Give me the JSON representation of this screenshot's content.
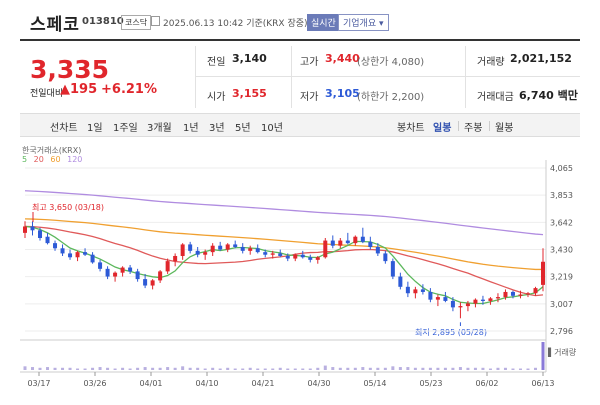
{
  "header": {
    "name": "스페코",
    "code": "013810",
    "market": "코스닥",
    "datetime": "2025.06.13 10:42 기준(KRX 장중)",
    "realtime_btn": "실시간",
    "company_btn": "기업개요 ▾"
  },
  "price": {
    "current": "3,335",
    "change_label": "전일대비",
    "change_amount": "▲195",
    "change_pct": "+6.21%",
    "color_up": "#e0262c",
    "color_down": "#2d5ad6"
  },
  "stats": {
    "prev_label": "전일",
    "prev_value": "3,140",
    "open_label": "시가",
    "open_value": "3,155",
    "high_label": "고가",
    "high_value": "3,440",
    "upper_limit": "(상한가 4,080)",
    "low_label": "저가",
    "low_value": "3,105",
    "lower_limit": "(하한가 2,200)",
    "volume_label": "거래량",
    "volume_value": "2,021,152",
    "amount_label": "거래대금",
    "amount_value": "6,740 백만"
  },
  "tabs": {
    "period_tabs": [
      "선차트",
      "1일",
      "1주일",
      "3개월",
      "1년",
      "3년",
      "5년",
      "10년"
    ],
    "candle_label": "봉차트",
    "candle_tabs": [
      "일봉",
      "주봉",
      "월봉"
    ],
    "selected_candle": "일봉"
  },
  "chart_legend": {
    "source": "한국거래소(KRX)",
    "ma": [
      {
        "name": "5",
        "color": "#5cb85c"
      },
      {
        "name": "20",
        "color": "#e05a5a"
      },
      {
        "name": "60",
        "color": "#f0a030"
      },
      {
        "name": "120",
        "color": "#b08ce0"
      }
    ]
  },
  "annotations": {
    "max": "최고 3,650 (03/18)",
    "min": "최저 2,895 (05/28)",
    "volume_label": "▌거래량"
  },
  "chart_data": {
    "type": "candlestick",
    "y_ticks": [
      "4,065",
      "3,853",
      "3,642",
      "3,430",
      "3,219",
      "3,007",
      "2,796"
    ],
    "ylim": [
      2796,
      4065
    ],
    "x_ticks": [
      "03/17",
      "03/26",
      "04/01",
      "04/10",
      "04/21",
      "04/30",
      "05/14",
      "05/23",
      "06/02",
      "06/13"
    ],
    "candles": [
      [
        3560,
        3650,
        3520,
        3610
      ],
      [
        3610,
        3650,
        3540,
        3580
      ],
      [
        3580,
        3600,
        3500,
        3520
      ],
      [
        3530,
        3560,
        3470,
        3480
      ],
      [
        3480,
        3500,
        3420,
        3440
      ],
      [
        3440,
        3470,
        3380,
        3400
      ],
      [
        3400,
        3430,
        3350,
        3370
      ],
      [
        3370,
        3420,
        3340,
        3410
      ],
      [
        3410,
        3440,
        3380,
        3390
      ],
      [
        3390,
        3410,
        3320,
        3330
      ],
      [
        3330,
        3350,
        3260,
        3280
      ],
      [
        3280,
        3300,
        3200,
        3220
      ],
      [
        3220,
        3260,
        3180,
        3250
      ],
      [
        3250,
        3300,
        3220,
        3290
      ],
      [
        3290,
        3310,
        3240,
        3260
      ],
      [
        3260,
        3280,
        3180,
        3200
      ],
      [
        3200,
        3240,
        3130,
        3150
      ],
      [
        3150,
        3200,
        3120,
        3190
      ],
      [
        3190,
        3270,
        3170,
        3260
      ],
      [
        3260,
        3360,
        3240,
        3340
      ],
      [
        3340,
        3400,
        3300,
        3380
      ],
      [
        3380,
        3480,
        3350,
        3470
      ],
      [
        3470,
        3490,
        3400,
        3420
      ],
      [
        3420,
        3450,
        3370,
        3390
      ],
      [
        3390,
        3430,
        3350,
        3410
      ],
      [
        3410,
        3480,
        3380,
        3460
      ],
      [
        3460,
        3490,
        3420,
        3430
      ],
      [
        3430,
        3480,
        3410,
        3470
      ],
      [
        3470,
        3500,
        3440,
        3450
      ],
      [
        3450,
        3480,
        3400,
        3420
      ],
      [
        3420,
        3460,
        3390,
        3440
      ],
      [
        3440,
        3470,
        3400,
        3410
      ],
      [
        3410,
        3430,
        3370,
        3390
      ],
      [
        3390,
        3420,
        3360,
        3400
      ],
      [
        3400,
        3430,
        3370,
        3380
      ],
      [
        3380,
        3400,
        3340,
        3360
      ],
      [
        3360,
        3400,
        3340,
        3390
      ],
      [
        3390,
        3420,
        3360,
        3370
      ],
      [
        3370,
        3390,
        3330,
        3350
      ],
      [
        3350,
        3380,
        3320,
        3370
      ],
      [
        3370,
        3520,
        3360,
        3500
      ],
      [
        3500,
        3540,
        3440,
        3460
      ],
      [
        3460,
        3520,
        3440,
        3500
      ],
      [
        3500,
        3560,
        3470,
        3480
      ],
      [
        3480,
        3540,
        3460,
        3530
      ],
      [
        3530,
        3600,
        3480,
        3490
      ],
      [
        3490,
        3530,
        3430,
        3450
      ],
      [
        3450,
        3480,
        3380,
        3400
      ],
      [
        3400,
        3420,
        3320,
        3340
      ],
      [
        3340,
        3360,
        3200,
        3220
      ],
      [
        3220,
        3250,
        3120,
        3140
      ],
      [
        3140,
        3180,
        3060,
        3090
      ],
      [
        3090,
        3140,
        3050,
        3120
      ],
      [
        3120,
        3160,
        3080,
        3100
      ],
      [
        3100,
        3130,
        3020,
        3040
      ],
      [
        3040,
        3080,
        2990,
        3060
      ],
      [
        3060,
        3100,
        3020,
        3030
      ],
      [
        3030,
        3060,
        2950,
        2980
      ],
      [
        2980,
        3020,
        2895,
        2990
      ],
      [
        2990,
        3030,
        2950,
        3010
      ],
      [
        3010,
        3050,
        2980,
        3040
      ],
      [
        3040,
        3070,
        3000,
        3030
      ],
      [
        3030,
        3060,
        3000,
        3050
      ],
      [
        3050,
        3090,
        3020,
        3060
      ],
      [
        3060,
        3120,
        3040,
        3100
      ],
      [
        3100,
        3110,
        3050,
        3070
      ],
      [
        3070,
        3110,
        3050,
        3080
      ],
      [
        3080,
        3100,
        3060,
        3090
      ],
      [
        3090,
        3140,
        3070,
        3130
      ],
      [
        3155,
        3440,
        3105,
        3335
      ]
    ],
    "volume": [
      5,
      4,
      3,
      4,
      3,
      3,
      3,
      2,
      2,
      3,
      4,
      3,
      2,
      3,
      2,
      3,
      4,
      3,
      3,
      4,
      3,
      5,
      3,
      3,
      2,
      3,
      2,
      3,
      2,
      2,
      3,
      2,
      2,
      2,
      3,
      2,
      2,
      2,
      2,
      3,
      6,
      4,
      3,
      3,
      3,
      4,
      3,
      3,
      3,
      5,
      4,
      4,
      3,
      3,
      3,
      3,
      3,
      3,
      4,
      3,
      3,
      3,
      2,
      3,
      3,
      2,
      2,
      2,
      3,
      38
    ]
  }
}
